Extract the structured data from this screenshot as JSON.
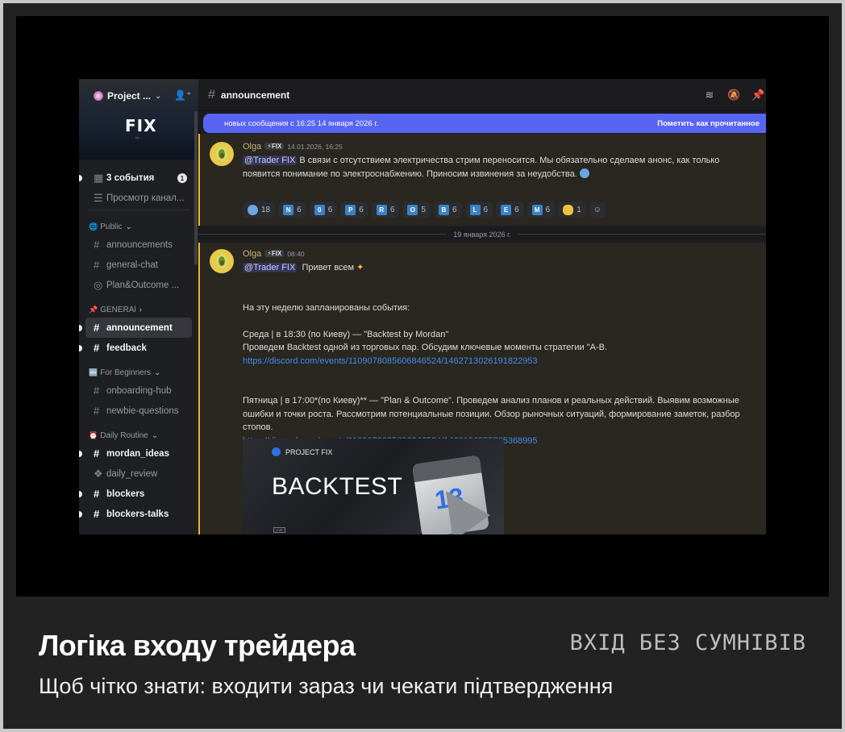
{
  "colors": {
    "accent": "#5865f2",
    "highlight": "#f0b232",
    "link": "#3e8ee8",
    "background": "#000000",
    "caption_bg": "#222222"
  },
  "server": {
    "name": "Project ...",
    "logo": "FIX",
    "logo_sub": "by ..."
  },
  "sidebar": {
    "items_top": [
      {
        "icon": "calendar-icon",
        "label": "3 события",
        "badge": "1"
      },
      {
        "icon": "browse-channels-icon",
        "label": "Просмотр канал..."
      }
    ],
    "categories": [
      {
        "label": "Public",
        "icon": "globe-icon",
        "channels": [
          {
            "label": "announcements",
            "icon": "hash-icon"
          },
          {
            "label": "general-chat",
            "icon": "hash-icon"
          },
          {
            "label": "Plan&Outcome ...",
            "icon": "stage-icon"
          }
        ]
      },
      {
        "label": "GENERAl",
        "icon": "pin-icon",
        "channels": [
          {
            "label": "announcement",
            "icon": "hash-icon",
            "active": true
          },
          {
            "label": "feedback",
            "icon": "hash-icon",
            "unread": true
          }
        ]
      },
      {
        "label": "For Beginners",
        "icon": "new-icon",
        "channels": [
          {
            "label": "onboarding-hub",
            "icon": "hash-icon"
          },
          {
            "label": "newbie-questions",
            "icon": "hash-icon"
          }
        ]
      },
      {
        "label": "Daily Routine",
        "icon": "clock-icon",
        "channels": [
          {
            "label": "mordan_ideas",
            "icon": "hash-icon",
            "unread": true
          },
          {
            "label": "daily_review",
            "icon": "forum-icon"
          },
          {
            "label": "blockers",
            "icon": "hash-icon",
            "unread": true
          },
          {
            "label": "blockers-talks",
            "icon": "hash-icon",
            "unread": true
          }
        ]
      }
    ]
  },
  "channel": {
    "title": "announcement"
  },
  "new_messages": {
    "text": "новых сообщения с 16:25 14 января 2026 г.",
    "action": "Пометить как прочитанное"
  },
  "messages": [
    {
      "author": "Olga",
      "tag": "⚡FIX",
      "time": "14.01.2026, 16:25",
      "mention": "@Trader FIX",
      "text": "В связи с отсутствием электричества стрим переносится. Мы обязательно сделаем анонс, как только появится понимание по электроснабжению. Приносим извинения за неудобства.",
      "reactions": [
        {
          "emoji": "👤",
          "count": "18"
        },
        {
          "emoji": "N",
          "count": "6"
        },
        {
          "emoji": "0",
          "count": "6"
        },
        {
          "emoji": "P",
          "count": "6"
        },
        {
          "emoji": "R",
          "count": "6"
        },
        {
          "emoji": "O",
          "count": "5"
        },
        {
          "emoji": "B",
          "count": "6"
        },
        {
          "emoji": "L",
          "count": "6"
        },
        {
          "emoji": "E",
          "count": "6"
        },
        {
          "emoji": "M",
          "count": "6"
        },
        {
          "emoji": "🤝",
          "count": "1"
        }
      ]
    },
    {
      "date_separator": "19 января 2026 г.",
      "author": "Olga",
      "tag": "⚡FIX",
      "time": "08:40",
      "mention": "@Trader FIX",
      "greeting": "Привет всем",
      "line1": "На эту неделю запланированы события:",
      "line2": "Среда | в 18:30 (по Киеву) — \"Backtest by Mordan\"",
      "line3": "Проведем Backtest одной из торговых пар. Обсудим ключевые моменты стратегии \"А-В.",
      "link1": "https://discord.com/events/1109078085606846524/1462713026191822953",
      "line4": "Пятница | в 17:00*(по Киеву)** — \"Plan & Outcome\". Проведем анализ планов и реальных действий. Выявим возможные ошибки и точки роста. Рассмотрим потенциальные позиции. Обзор рыночных ситуаций, формирование заметок, разбор стопов.",
      "link2": "https://discord.com/events/1109078085606846524/1460196255765368995",
      "embed": {
        "brand": "PROJECT FIX",
        "title": "BACKTEST",
        "calendar_number": "13"
      }
    }
  ],
  "caption": {
    "title": "Логіка входу трейдера",
    "tag": "ВХІД БЕЗ СУМНІВІВ",
    "subtitle": "Щоб чітко знати: входити зараз чи чекати підтвердження"
  }
}
